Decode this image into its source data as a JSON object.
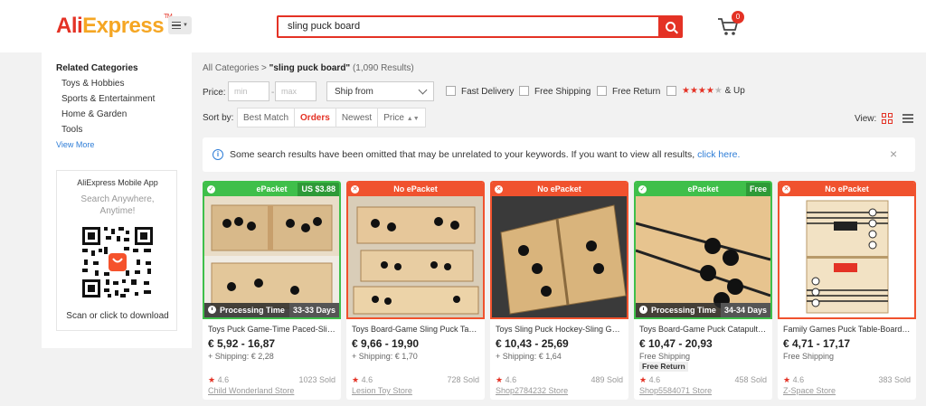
{
  "header": {
    "logo_ali": "Ali",
    "logo_express": "Express",
    "logo_tm": "TM",
    "search_value": "sling puck board",
    "cart_count": "0"
  },
  "sidebar": {
    "title": "Related Categories",
    "items": [
      "Toys & Hobbies",
      "Sports & Entertainment",
      "Home & Garden",
      "Tools"
    ],
    "view_more": "View More",
    "app_title": "AliExpress Mobile App",
    "app_subtitle": "Search Anywhere, Anytime!",
    "scan_text": "Scan or click to download"
  },
  "breadcrumb": {
    "all": "All Categories",
    "sep": ">",
    "query": "\"sling puck board\"",
    "results": "(1,090 Results)"
  },
  "filters": {
    "price_label": "Price:",
    "min_placeholder": "min",
    "dash": "-",
    "max_placeholder": "max",
    "ship_from": "Ship from",
    "fast_delivery": "Fast Delivery",
    "free_shipping": "Free Shipping",
    "free_return": "Free Return",
    "stars_on": "★★★★",
    "stars_off": "★",
    "and_up": "& Up"
  },
  "sort": {
    "label": "Sort by:",
    "options": [
      "Best Match",
      "Orders",
      "Newest",
      "Price"
    ],
    "active": "Orders",
    "view_label": "View:"
  },
  "notice": {
    "text": "Some search results have been omitted that may be unrelated to your keywords. If you want to view all results,",
    "link": "click here.",
    "close": "×"
  },
  "products": [
    {
      "packet": "ePacket",
      "packet_type": "green",
      "packet_extra": "US $3.88",
      "processing": "Processing Time",
      "processing_days": "33-33 Days",
      "title": "Toys Puck Game-Time Paced-Sling Puck Winner",
      "price": "€ 5,92 - 16,87",
      "shipping": "+ Shipping: € 2,28",
      "badge": "",
      "rating": "4.6",
      "sold": "1023 Sold",
      "store": "Child Wonderland Store"
    },
    {
      "packet": "No ePacket",
      "packet_type": "red",
      "packet_extra": "",
      "processing": "",
      "processing_days": "",
      "title": "Toys Board-Game Sling Puck Table Game",
      "price": "€ 9,66 - 19,90",
      "shipping": "+ Shipping: € 1,70",
      "badge": "",
      "rating": "4.6",
      "sold": "728 Sold",
      "store": "Lesion Toy Store"
    },
    {
      "packet": "No ePacket",
      "packet_type": "red",
      "packet_extra": "",
      "processing": "",
      "processing_days": "",
      "title": "Toys Sling Puck Hockey-Sling Game Board",
      "price": "€ 10,43 - 25,69",
      "shipping": "+ Shipping: € 1,64",
      "badge": "",
      "rating": "4.6",
      "sold": "489 Sold",
      "store": "Shop2784232 Store"
    },
    {
      "packet": "ePacket",
      "packet_type": "green",
      "packet_extra": "Free",
      "processing": "Processing Time",
      "processing_days": "34-34 Days",
      "title": "Toys Board-Game Puck Catapult-Chess Game",
      "price": "€ 10,47 - 20,93",
      "shipping": "Free Shipping",
      "badge": "Free Return",
      "rating": "4.6",
      "sold": "458 Sold",
      "store": "Shop5584071 Store"
    },
    {
      "packet": "No ePacket",
      "packet_type": "red",
      "packet_extra": "",
      "processing": "",
      "processing_days": "",
      "title": "Family Games Puck Table-Board Hockey Game",
      "price": "€ 4,71 - 17,17",
      "shipping": "Free Shipping",
      "badge": "",
      "rating": "4.6",
      "sold": "383 Sold",
      "store": "Z-Space Store"
    }
  ],
  "colors": {
    "accent": "#e43225",
    "epacket_green": "#3fbf4a",
    "no_epacket_red": "#f0522e",
    "link_blue": "#2e7dd7"
  }
}
